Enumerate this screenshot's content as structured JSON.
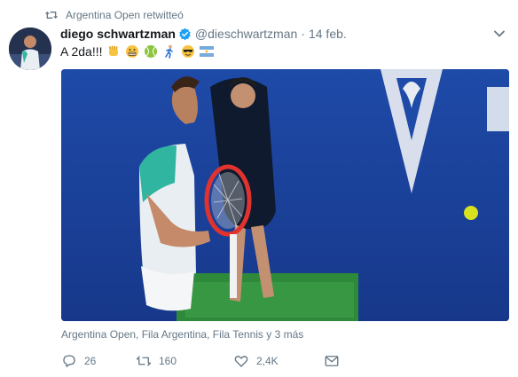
{
  "retweet_context": {
    "icon": "retweet-icon",
    "label": "Argentina Open retwitteó"
  },
  "tweet": {
    "author": {
      "display_name": "diego schwartzman",
      "verified": true,
      "handle": "@dieschwartzman"
    },
    "separator": "·",
    "date": "14 feb.",
    "text": "A 2da!!!",
    "emojis": [
      "fist-emoji",
      "grimace-emoji",
      "tennis-ball-emoji",
      "runner-emoji",
      "sunglasses-emoji",
      "argentina-flag-emoji"
    ],
    "media_tags": "Argentina Open, Fila Argentina, Fila Tennis y 3 más"
  },
  "actions": {
    "reply": {
      "icon": "reply-icon",
      "count": "26"
    },
    "retweet": {
      "icon": "retweet-icon",
      "count": "160"
    },
    "like": {
      "icon": "heart-icon",
      "count": "2,4K"
    },
    "dm": {
      "icon": "envelope-icon"
    }
  },
  "colors": {
    "verified": "#1da1f2",
    "muted": "#657786",
    "court_blue": "#1a3f9a",
    "icon_gray": "#657786"
  }
}
